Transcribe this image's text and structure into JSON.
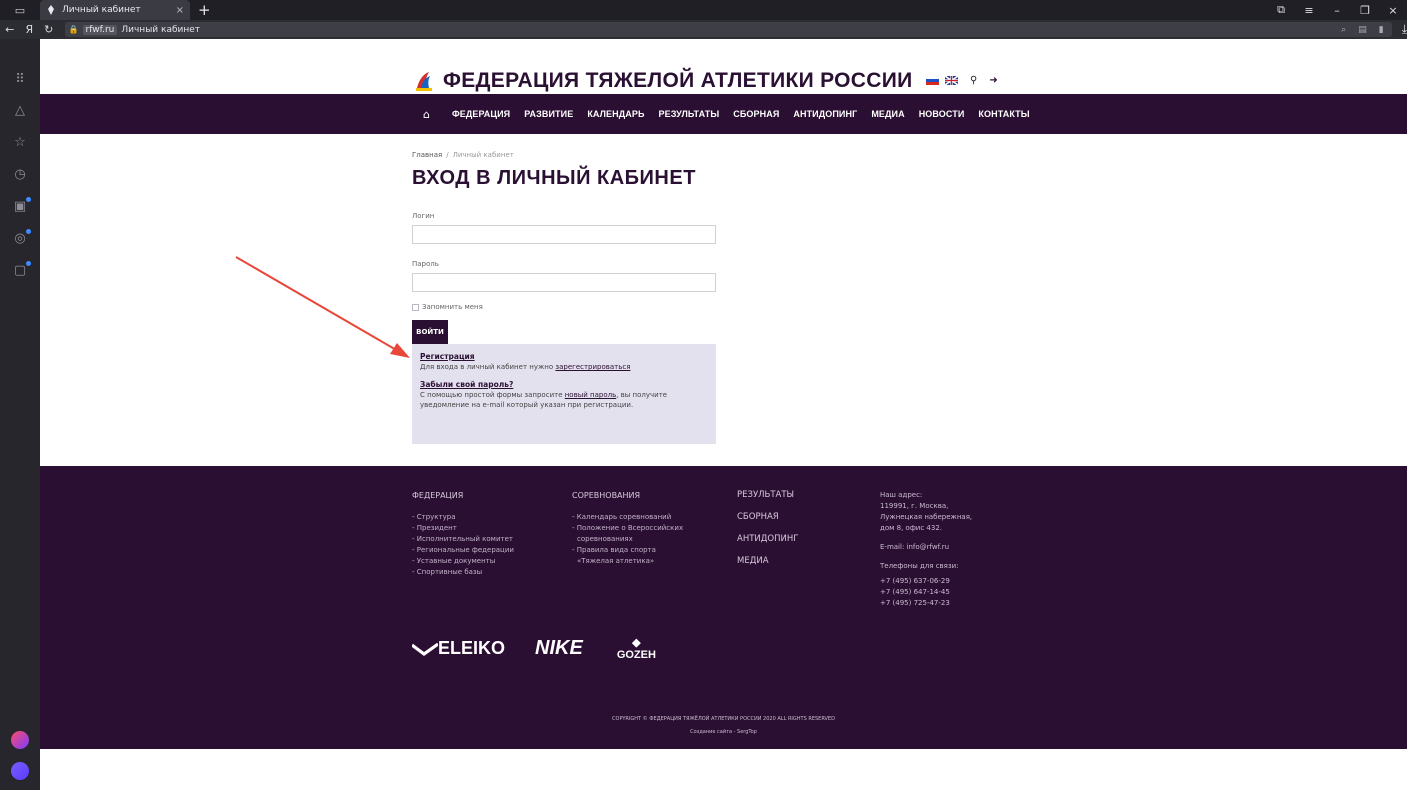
{
  "browser": {
    "tab_title": "Личный кабинет",
    "tab_close": "×",
    "new_tab": "+",
    "address": {
      "domain": "rfwf.ru",
      "page_title": "Личный кабинет"
    },
    "window_controls": [
      "⧉",
      "≡",
      "–",
      "❐",
      "×"
    ]
  },
  "site": {
    "logo_text": "ФЕДЕРАЦИЯ ТЯЖЕЛОЙ АТЛЕТИКИ РОССИИ",
    "nav": [
      "ФЕДЕРАЦИЯ",
      "РАЗВИТИЕ",
      "КАЛЕНДАРЬ",
      "РЕЗУЛЬТАТЫ",
      "СБОРНАЯ",
      "АНТИДОПИНГ",
      "МЕДИА",
      "НОВОСТИ",
      "КОНТАКТЫ"
    ]
  },
  "breadcrumb": {
    "home": "Главная",
    "separator": "/",
    "current": "Личный кабинет"
  },
  "page_title": "ВХОД В ЛИЧНЫЙ КАБИНЕТ",
  "form": {
    "login_label": "Логин",
    "password_label": "Пароль",
    "remember_label": "Запомнить меня",
    "submit_label": "ВОЙТИ"
  },
  "info": {
    "register_heading": "Регистрация",
    "register_text": "Для входа в личный кабинет нужно",
    "register_link": "зарегестрироваться",
    "forgot_heading": "Забыли свой пароль?",
    "forgot_text_1": "С помощью простой формы запросите",
    "forgot_link": "новый пароль",
    "forgot_text_2": ", вы получите уведомление на e-mail который указан при регистрации."
  },
  "footer": {
    "col1": {
      "heading": "ФЕДЕРАЦИЯ",
      "links": [
        "- Структура",
        "- Президент",
        "- Исполнительный комитет",
        "- Региональные федерации",
        "- Уставные документы",
        "- Спортивные базы"
      ]
    },
    "col2": {
      "heading": "СОРЕВНОВАНИЯ",
      "links": [
        "- Календарь соревнований",
        "- Положение о Всероссийских",
        "соревнованиях",
        "- Правила вида спорта",
        "«Тяжелая атлетика»"
      ]
    },
    "col3": [
      "РЕЗУЛЬТАТЫ",
      "СБОРНАЯ",
      "АНТИДОПИНГ",
      "МЕДИА"
    ],
    "col4": {
      "address_label": "Наш адрес:",
      "address_lines": [
        "119991, г. Москва,",
        "Лужнецкая набережная,",
        "дом 8, офис 432."
      ],
      "email": "E-mail: info@rfwf.ru",
      "phones_label": "Телефоны для связи:",
      "phones": [
        "+7 (495) 637-06-29",
        "+7 (495) 647-14-45",
        "+7 (495) 725-47-23"
      ]
    },
    "sponsors": [
      "ELEIKO",
      "NIKE",
      "GOZEH"
    ],
    "copyright": "COPYRIGHT © ФЕДЕРАЦИЯ ТЯЖЁЛОЙ АТЛЕТИКИ РОССИИ 2020 ALL RIGHTS RESERVED",
    "credits": "Создание сайта - SergTop"
  },
  "colors": {
    "brand_dark": "#2b0f32",
    "info_bg": "#e4e1ee",
    "arrow": "#e8473a"
  }
}
